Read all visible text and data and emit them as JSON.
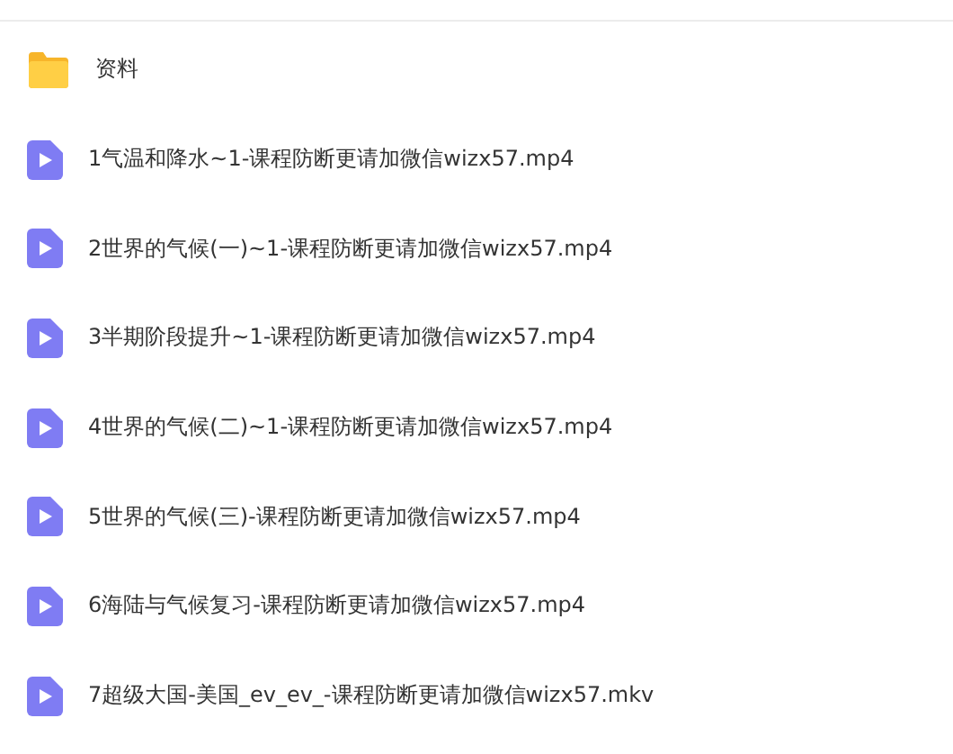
{
  "files": [
    {
      "kind": "folder",
      "name": "资料"
    },
    {
      "kind": "video",
      "name": "1气温和降水~1-课程防断更请加微信wizx57.mp4"
    },
    {
      "kind": "video",
      "name": "2世界的气候(一)~1-课程防断更请加微信wizx57.mp4"
    },
    {
      "kind": "video",
      "name": "3半期阶段提升~1-课程防断更请加微信wizx57.mp4"
    },
    {
      "kind": "video",
      "name": "4世界的气候(二)~1-课程防断更请加微信wizx57.mp4"
    },
    {
      "kind": "video",
      "name": "5世界的气候(三)-课程防断更请加微信wizx57.mp4"
    },
    {
      "kind": "video",
      "name": "6海陆与气候复习-课程防断更请加微信wizx57.mp4"
    },
    {
      "kind": "video",
      "name": "7超级大国-美国_ev_ev_-课程防断更请加微信wizx57.mkv"
    }
  ]
}
